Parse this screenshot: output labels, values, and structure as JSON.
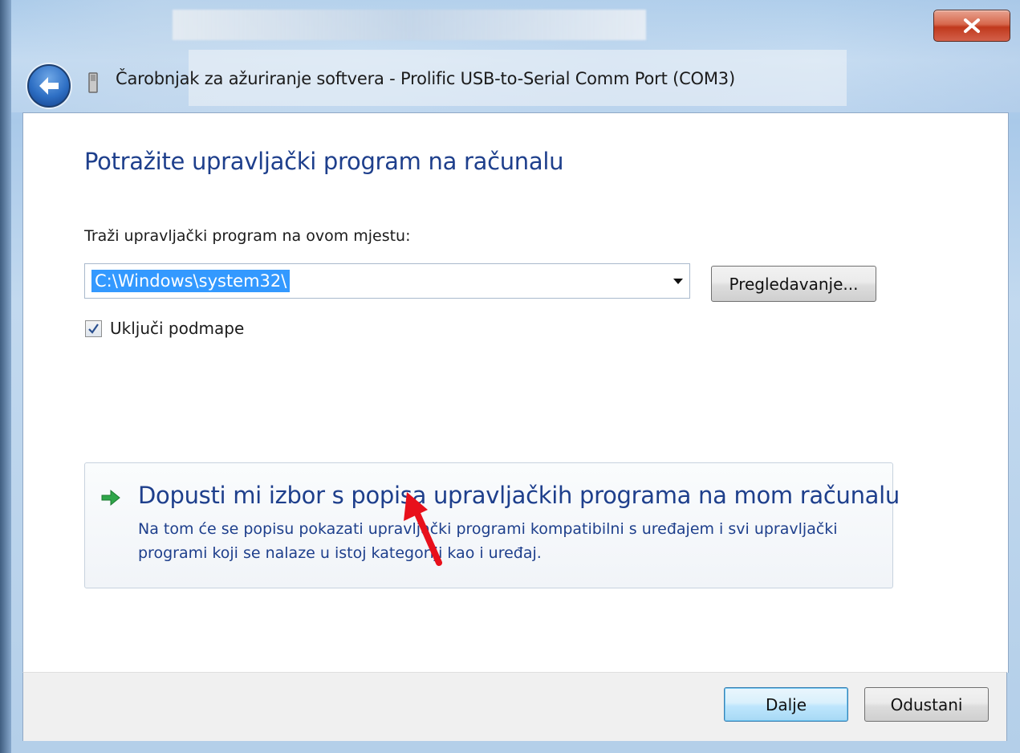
{
  "window": {
    "title": "Čarobnjak za ažuriranje softvera - Prolific USB-to-Serial Comm Port (COM3)",
    "close_icon": "close-icon",
    "back_icon": "back-arrow-icon"
  },
  "main": {
    "heading": "Potražite upravljački program na računalu",
    "search_label": "Traži upravljački program na ovom mjestu:",
    "path_value": "C:\\Windows\\system32\\",
    "browse_label": "Pregledavanje...",
    "include_subfolders_label": "Uključi podmape",
    "include_subfolders_checked": true
  },
  "command_link": {
    "title": "Dopusti mi izbor s popisa upravljačkih programa na mom računalu",
    "description": "Na tom će se popisu pokazati upravljački programi kompatibilni s uređajem i svi upravljački programi koji se nalaze u istoj kategoriji kao i uređaj.",
    "icon": "green-arrow-icon"
  },
  "footer": {
    "next_label": "Dalje",
    "cancel_label": "Odustani"
  },
  "colors": {
    "heading": "#1e3f8c",
    "selection": "#3399ff",
    "annotation_arrow": "#e8101b"
  }
}
